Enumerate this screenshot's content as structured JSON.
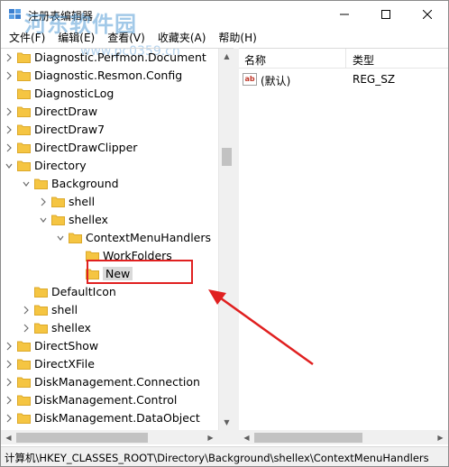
{
  "window": {
    "title": "注册表编辑器",
    "watermark": "河东软件园",
    "watermark_url": "www.pc0359.cn"
  },
  "menu": {
    "items": [
      "文件(F)",
      "编辑(E)",
      "查看(V)",
      "收藏夹(A)",
      "帮助(H)"
    ]
  },
  "tree": {
    "items": [
      {
        "label": "Diagnostic.Perfmon.Document",
        "level": 0,
        "expander": "collapsed"
      },
      {
        "label": "Diagnostic.Resmon.Config",
        "level": 0,
        "expander": "collapsed"
      },
      {
        "label": "DiagnosticLog",
        "level": 0,
        "expander": "none"
      },
      {
        "label": "DirectDraw",
        "level": 0,
        "expander": "collapsed"
      },
      {
        "label": "DirectDraw7",
        "level": 0,
        "expander": "collapsed"
      },
      {
        "label": "DirectDrawClipper",
        "level": 0,
        "expander": "collapsed"
      },
      {
        "label": "Directory",
        "level": 0,
        "expander": "expanded"
      },
      {
        "label": "Background",
        "level": 1,
        "expander": "expanded"
      },
      {
        "label": "shell",
        "level": 2,
        "expander": "collapsed"
      },
      {
        "label": "shellex",
        "level": 2,
        "expander": "expanded"
      },
      {
        "label": "ContextMenuHandlers",
        "level": 3,
        "expander": "expanded"
      },
      {
        "label": "WorkFolders",
        "level": 4,
        "expander": "none"
      },
      {
        "label": "New",
        "level": 4,
        "expander": "none",
        "selected": true
      },
      {
        "label": "DefaultIcon",
        "level": 1,
        "expander": "none"
      },
      {
        "label": "shell",
        "level": 1,
        "expander": "collapsed"
      },
      {
        "label": "shellex",
        "level": 1,
        "expander": "collapsed"
      },
      {
        "label": "DirectShow",
        "level": 0,
        "expander": "collapsed"
      },
      {
        "label": "DirectXFile",
        "level": 0,
        "expander": "collapsed"
      },
      {
        "label": "DiskManagement.Connection",
        "level": 0,
        "expander": "collapsed"
      },
      {
        "label": "DiskManagement.Control",
        "level": 0,
        "expander": "collapsed"
      },
      {
        "label": "DiskManagement.DataObject",
        "level": 0,
        "expander": "collapsed"
      }
    ]
  },
  "list": {
    "col_name": "名称",
    "col_type": "类型",
    "rows": [
      {
        "name": "(默认)",
        "type": "REG_SZ"
      }
    ]
  },
  "status": {
    "path": "计算机\\HKEY_CLASSES_ROOT\\Directory\\Background\\shellex\\ContextMenuHandlers"
  },
  "colors": {
    "folder": "#f5c542",
    "folder_dark": "#dca92a",
    "annotation": "#e02020",
    "selection": "#d9d9d9"
  }
}
